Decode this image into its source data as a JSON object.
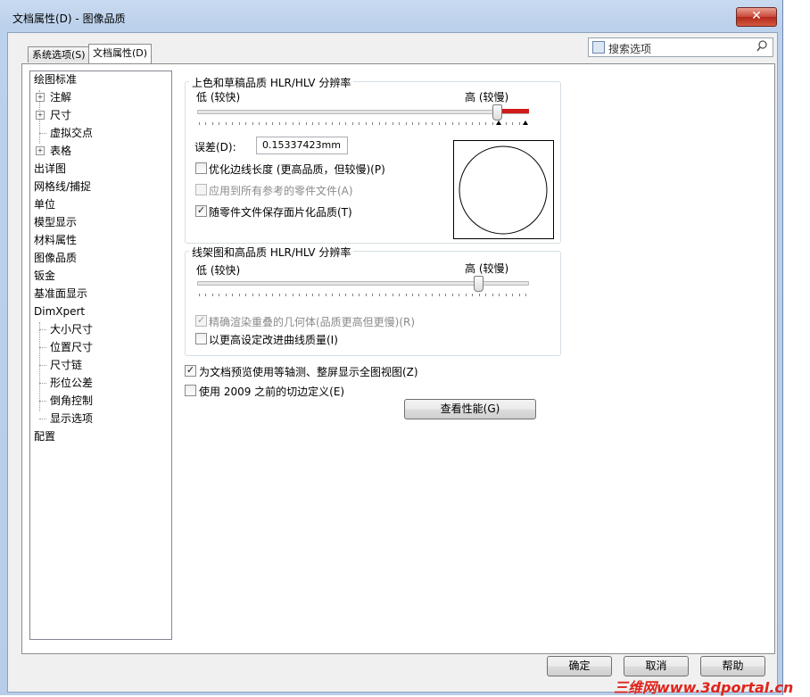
{
  "window": {
    "title": "文档属性(D) - 图像品质",
    "close_glyph": "✕"
  },
  "tabs": [
    {
      "label": "系统选项(S)",
      "active": false
    },
    {
      "label": "文档属性(D)",
      "active": true
    }
  ],
  "search": {
    "placeholder": "搜索选项"
  },
  "tree": {
    "items": [
      {
        "label": "绘图标准"
      },
      {
        "label": "注解",
        "expander": "+"
      },
      {
        "label": "尺寸",
        "expander": "+"
      },
      {
        "label": "虚拟交点"
      },
      {
        "label": "表格",
        "expander": "+"
      },
      {
        "label": "出详图"
      },
      {
        "label": "网格线/捕捉"
      },
      {
        "label": "单位"
      },
      {
        "label": "模型显示"
      },
      {
        "label": "材料属性"
      },
      {
        "label": "图像品质",
        "selected": true
      },
      {
        "label": "钣金"
      },
      {
        "label": "基准面显示"
      },
      {
        "label": "DimXpert"
      },
      {
        "label": "大小尺寸"
      },
      {
        "label": "位置尺寸"
      },
      {
        "label": "尺寸链"
      },
      {
        "label": "形位公差"
      },
      {
        "label": "倒角控制"
      },
      {
        "label": "显示选项"
      },
      {
        "label": "配置"
      }
    ]
  },
  "shaded_group": {
    "title": "上色和草稿品质 HLR/HLV 分辨率",
    "low_label": "低 (较快)",
    "high_label": "高 (较慢)",
    "slider_value": 0.92,
    "deviation_label": "误差(D):",
    "deviation_value": "0.15337423mm",
    "checkboxes": [
      {
        "label": "优化边线长度 (更高品质，但较慢)(P)",
        "checked": false,
        "disabled": false
      },
      {
        "label": "应用到所有参考的零件文件(A)",
        "checked": false,
        "disabled": true
      },
      {
        "label": "随零件文件保存面片化品质(T)",
        "checked": true,
        "disabled": false
      }
    ]
  },
  "wireframe_group": {
    "title": "线架图和高品质 HLR/HLV 分辨率",
    "low_label": "低 (较快)",
    "high_label": "高 (较慢)",
    "slider_value": 0.86,
    "checkboxes": [
      {
        "label": "精确渲染重叠的几何体(品质更高但更慢)(R)",
        "checked": true,
        "disabled": true
      },
      {
        "label": "以更高设定改进曲线质量(I)",
        "checked": false,
        "disabled": false
      }
    ]
  },
  "options": [
    {
      "label": "为文档预览使用等轴测、整屏显示全图视图(Z)",
      "checked": true
    },
    {
      "label": "使用 2009 之前的切边定义(E)",
      "checked": false
    }
  ],
  "performance_button": "查看性能(G)",
  "footer": {
    "ok": "确定",
    "cancel": "取消",
    "help": "帮助"
  },
  "watermark": "三维网www.3dportal.cn",
  "colors": {
    "slider_fill": "#d11a1a",
    "close_button": "#c9473b",
    "watermark": "#e0241c"
  }
}
